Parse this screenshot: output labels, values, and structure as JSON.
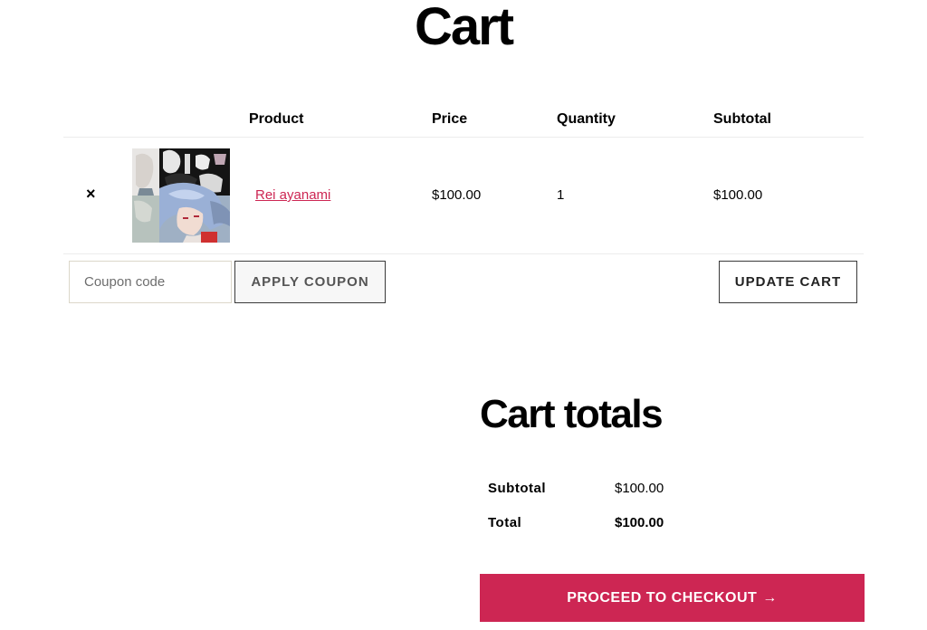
{
  "page": {
    "title": "Cart"
  },
  "cart_table": {
    "headers": {
      "product": "Product",
      "price": "Price",
      "quantity": "Quantity",
      "subtotal": "Subtotal"
    },
    "items": [
      {
        "remove_symbol": "×",
        "image_description": "Rei ayanami product thumbnail",
        "name": "Rei ayanami",
        "price": "$100.00",
        "quantity": "1",
        "subtotal": "$100.00"
      }
    ]
  },
  "actions": {
    "coupon_placeholder": "Coupon code",
    "coupon_value": "",
    "apply_coupon_label": "APPLY COUPON",
    "update_cart_label": "UPDATE CART"
  },
  "totals": {
    "title": "Cart totals",
    "subtotal_label": "Subtotal",
    "subtotal_value": "$100.00",
    "total_label": "Total",
    "total_value": "$100.00",
    "checkout_label": "PROCEED TO CHECKOUT",
    "checkout_arrow": "→"
  },
  "colors": {
    "accent": "#cd2653",
    "border": "#ececec",
    "button_border": "#3a3a3a"
  },
  "icons": {
    "remove": "close-icon",
    "checkout_arrow": "arrow-right-icon"
  }
}
